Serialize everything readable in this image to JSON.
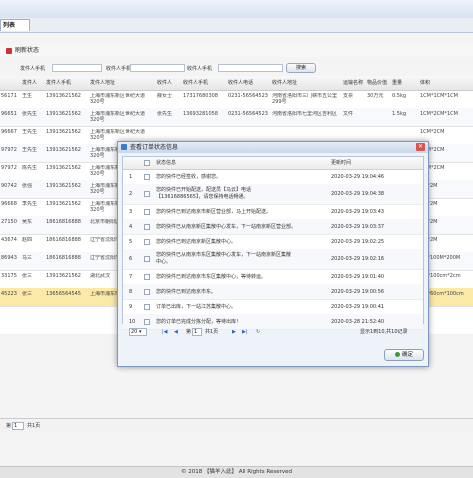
{
  "app": {
    "tab_label": "列表"
  },
  "toolbar": {
    "refresh_label": "刷新状态"
  },
  "filters": {
    "sender_label": "发件人手机",
    "receiver_label": "收件人手机",
    "search_label": "搜索"
  },
  "grid": {
    "headers": [
      "发件人",
      "发件人手机",
      "发件人地址",
      "收件人",
      "收件人手机",
      "收件人电话",
      "收件人地址",
      "运输名称",
      "物品价值",
      "重量",
      "体积"
    ],
    "rows": [
      [
        "王生",
        "13913621562",
        "上海市浦东新区世纪大道320号",
        "薛女士",
        "17317680308",
        "0231-56564523",
        "河南省洛阳市三门峡市五公里299号",
        "支票",
        "30万元",
        "0.5kg",
        "1CM*1CM*1CM"
      ],
      [
        "张先生",
        "13913621562",
        "上海市浦东新区世纪大道320号",
        "张先生",
        "13693281058",
        "0231-56564523",
        "河南省洛阳市七里河区吉利区",
        "文件",
        "",
        "1.5kg",
        "1CM*2CM*1CM"
      ],
      [
        "王先生",
        "13913621562",
        "上海市浦东新区世纪大道320号",
        "",
        "",
        "",
        "",
        "",
        "",
        "",
        "1CM*2CM"
      ],
      [
        "王先生",
        "13913621562",
        "上海市浦东新区世纪大道320号",
        "",
        "",
        "",
        "",
        "",
        "",
        "",
        "1CM*2CM"
      ],
      [
        "陈先生",
        "13913621562",
        "上海市浦东新区世纪大道320号",
        "",
        "",
        "",
        "",
        "",
        "",
        "",
        "1CM*2CM"
      ],
      [
        "张强",
        "13913621562",
        "上海市浦东新区世纪大道320号",
        "",
        "",
        "",
        "",
        "",
        "",
        "",
        "1M*2M"
      ],
      [
        "李先生",
        "13913621562",
        "上海市浦东新区世纪大道320号",
        "",
        "",
        "",
        "",
        "",
        "",
        "",
        "1M*2M"
      ],
      [
        "吴东",
        "18616816888",
        "北京市朝阳区建国路399号",
        "",
        "",
        "",
        "",
        "",
        "",
        "",
        "1M*2M"
      ],
      [
        "赵四",
        "18616816888",
        "辽宁省沈阳市和平区",
        "",
        "",
        "",
        "",
        "",
        "",
        "",
        "1M*2M"
      ],
      [
        "马三",
        "18616816888",
        "辽宁省沈阳市",
        "",
        "",
        "",
        "",
        "",
        "",
        "",
        "1M*100M*200M"
      ],
      [
        "张三",
        "13913621562",
        "湖北武汉",
        "",
        "",
        "",
        "",
        "",
        "",
        "",
        "cm*100cm*2cm"
      ],
      [
        "张三",
        "13656564545",
        "上海市浦东环路",
        "",
        "",
        "",
        "",
        "",
        "",
        "",
        "cm*60cm*100cm"
      ]
    ],
    "row_ids": [
      "56171",
      "96651",
      "96667",
      "97972",
      "97972",
      "90742",
      "96668",
      "27150",
      "43674",
      "86943",
      "33175",
      "45223"
    ]
  },
  "pager": {
    "page_label": "第",
    "page_value": "1",
    "total_label": "共1页"
  },
  "footer": {
    "text": "© 2018 【猫羊入此】 All Rights Reserved"
  },
  "modal": {
    "title": "查看订单状态信息",
    "col_status": "状态信息",
    "col_time": "更新时间",
    "rows": [
      {
        "n": "1",
        "status": [
          "您的快件已经签收，感谢您。"
        ],
        "time": "2020-03-29 19:04:46"
      },
      {
        "n": "2",
        "status": [
          "您的快件已开始配送，配送员【马云】电话",
          "【13616886565】，请您保持电话畅通。"
        ],
        "time": "2020-03-29 19:04:38"
      },
      {
        "n": "3",
        "status": [
          "您的快件已到达南京市新区营业部，马上开始配送。"
        ],
        "time": "2020-03-29 19:03:43"
      },
      {
        "n": "4",
        "status": [
          "您的快件已从南京新区集散中心发车，下一站南京新区营业部。"
        ],
        "time": "2020-03-29 19:03:37"
      },
      {
        "n": "5",
        "status": [
          "您的快件已到达南京新区集散中心。"
        ],
        "time": "2020-03-29 19:02:25"
      },
      {
        "n": "6",
        "status": [
          "您的快件已从南京市东区集散中心发车，下一站南京新区集散",
          "中心。"
        ],
        "time": "2020-03-29 19:02:16"
      },
      {
        "n": "7",
        "status": [
          "您的快件已到达南京市东区集散中心，等待转运。"
        ],
        "time": "2020-03-29 19:01:40"
      },
      {
        "n": "8",
        "status": [
          "您的快件已到达南京市东。"
        ],
        "time": "2020-03-29 19:00:56"
      },
      {
        "n": "9",
        "status": [
          "订单已出库，下一站江苏集散中心。"
        ],
        "time": "2020-03-29 19:00:41"
      },
      {
        "n": "10",
        "status": [
          "您的订单已完成分拣分配，等待出库！"
        ],
        "time": "2020-03-28 21:52:40"
      }
    ],
    "pager": {
      "page_size": "20",
      "page_label": "第",
      "page_value": "1",
      "total_label": "共1页",
      "summary": "显示1到10,共10记录"
    },
    "ok_label": "确定"
  }
}
